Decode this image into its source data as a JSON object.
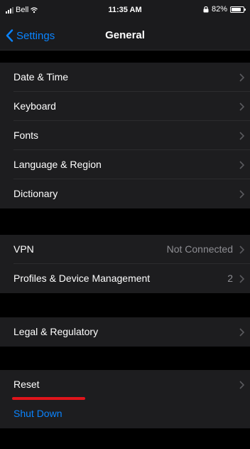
{
  "status": {
    "carrier": "Bell",
    "time": "11:35 AM",
    "battery": "82%",
    "battery_level": 0.82
  },
  "nav": {
    "back_label": "Settings",
    "title": "General"
  },
  "groups": [
    {
      "rows": [
        {
          "label": "Date & Time"
        },
        {
          "label": "Keyboard"
        },
        {
          "label": "Fonts"
        },
        {
          "label": "Language & Region"
        },
        {
          "label": "Dictionary"
        }
      ]
    },
    {
      "rows": [
        {
          "label": "VPN",
          "value": "Not Connected"
        },
        {
          "label": "Profiles & Device Management",
          "value": "2"
        }
      ]
    },
    {
      "rows": [
        {
          "label": "Legal & Regulatory"
        }
      ]
    },
    {
      "rows": [
        {
          "label": "Reset"
        },
        {
          "label": "Shut Down"
        }
      ]
    }
  ],
  "colors": {
    "accent": "#0a84ff",
    "annotation": "#e0141b",
    "cell_bg": "#1d1d1f",
    "page_bg": "#000000"
  }
}
